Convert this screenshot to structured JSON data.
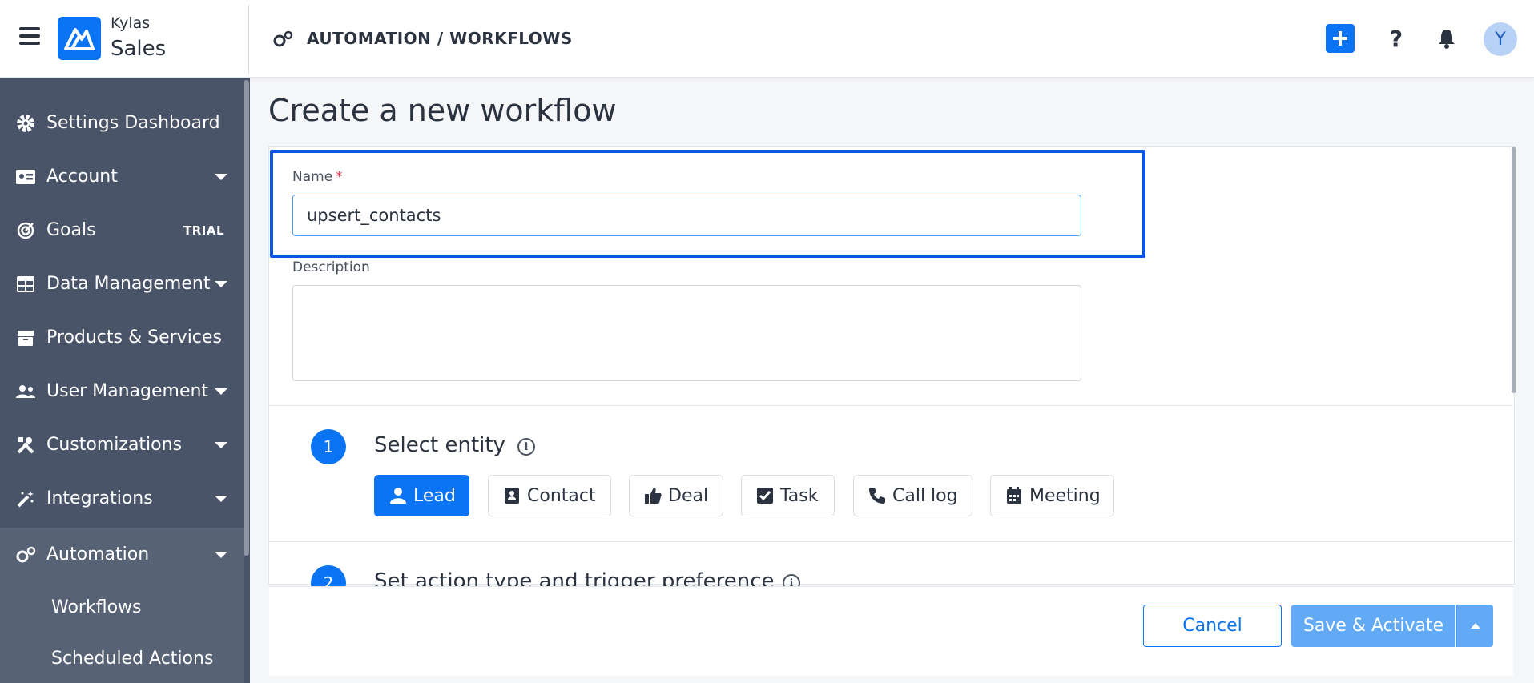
{
  "header": {
    "brand_top": "Kylas",
    "brand_bottom": "Sales",
    "breadcrumb": "AUTOMATION / WORKFLOWS",
    "help_label": "?",
    "avatar_initial": "Y"
  },
  "sidebar": {
    "items": [
      {
        "label": "Settings Dashboard",
        "icon": "gear-icon"
      },
      {
        "label": "Account",
        "icon": "id-card-icon"
      },
      {
        "label": "Goals",
        "icon": "target-icon",
        "badge": "TRIAL"
      },
      {
        "label": "Data Management",
        "icon": "table-icon"
      },
      {
        "label": "Products & Services",
        "icon": "box-icon"
      },
      {
        "label": "User Management",
        "icon": "users-icon"
      },
      {
        "label": "Customizations",
        "icon": "tools-icon"
      },
      {
        "label": "Integrations",
        "icon": "magic-wand-icon"
      },
      {
        "label": "Automation",
        "icon": "gears-icon"
      }
    ],
    "subitems": [
      {
        "label": "Workflows"
      },
      {
        "label": "Scheduled Actions"
      }
    ]
  },
  "main": {
    "title": "Create a new workflow",
    "name_label": "Name",
    "required_mark": "*",
    "name_value": "upsert_contacts",
    "description_label": "Description",
    "steps": [
      {
        "number": "1",
        "title": "Select entity",
        "info": "i"
      },
      {
        "number": "2",
        "title": "Set action type and trigger preference",
        "info": "i"
      }
    ],
    "entities": [
      {
        "label": "Lead",
        "icon": "user-icon",
        "selected": true
      },
      {
        "label": "Contact",
        "icon": "contact-card-icon",
        "selected": false
      },
      {
        "label": "Deal",
        "icon": "thumbs-up-icon",
        "selected": false
      },
      {
        "label": "Task",
        "icon": "check-square-icon",
        "selected": false
      },
      {
        "label": "Call log",
        "icon": "phone-icon",
        "selected": false
      },
      {
        "label": "Meeting",
        "icon": "calendar-icon",
        "selected": false
      }
    ]
  },
  "footer": {
    "cancel_label": "Cancel",
    "save_label": "Save & Activate"
  },
  "colors": {
    "primary": "#0b74f5",
    "sidebar_bg": "#4a5468",
    "highlight_border": "#0b55e6"
  }
}
